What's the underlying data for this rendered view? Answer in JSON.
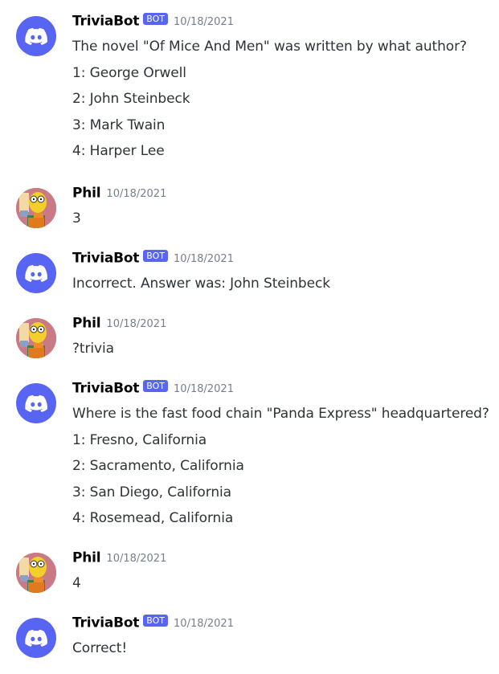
{
  "bot_badge": "BOT",
  "colors": {
    "blurple": "#5865f2",
    "username": "#060607",
    "text": "#2e3338",
    "timestamp": "#747f8d",
    "user_avatar_bg": "#c97a84"
  },
  "messages": [
    {
      "author": "TriviaBot",
      "is_bot": true,
      "timestamp": "10/18/2021",
      "lines": [
        "The novel \"Of Mice And Men\" was written by what author?",
        "1:  George Orwell",
        "2:  John Steinbeck",
        "3:  Mark Twain",
        "4:  Harper Lee"
      ]
    },
    {
      "author": "Phil",
      "is_bot": false,
      "timestamp": "10/18/2021",
      "lines": [
        "3"
      ]
    },
    {
      "author": "TriviaBot",
      "is_bot": true,
      "timestamp": "10/18/2021",
      "lines": [
        "Incorrect. Answer was: John Steinbeck"
      ]
    },
    {
      "author": "Phil",
      "is_bot": false,
      "timestamp": "10/18/2021",
      "lines": [
        "?trivia"
      ]
    },
    {
      "author": "TriviaBot",
      "is_bot": true,
      "timestamp": "10/18/2021",
      "lines": [
        "Where is the fast food chain \"Panda Express\" headquartered?",
        "1:  Fresno, California",
        "2:  Sacramento, California",
        "3:  San Diego, California",
        "4:  Rosemead, California"
      ]
    },
    {
      "author": "Phil",
      "is_bot": false,
      "timestamp": "10/18/2021",
      "lines": [
        "4"
      ]
    },
    {
      "author": "TriviaBot",
      "is_bot": true,
      "timestamp": "10/18/2021",
      "lines": [
        "Correct!"
      ]
    }
  ]
}
